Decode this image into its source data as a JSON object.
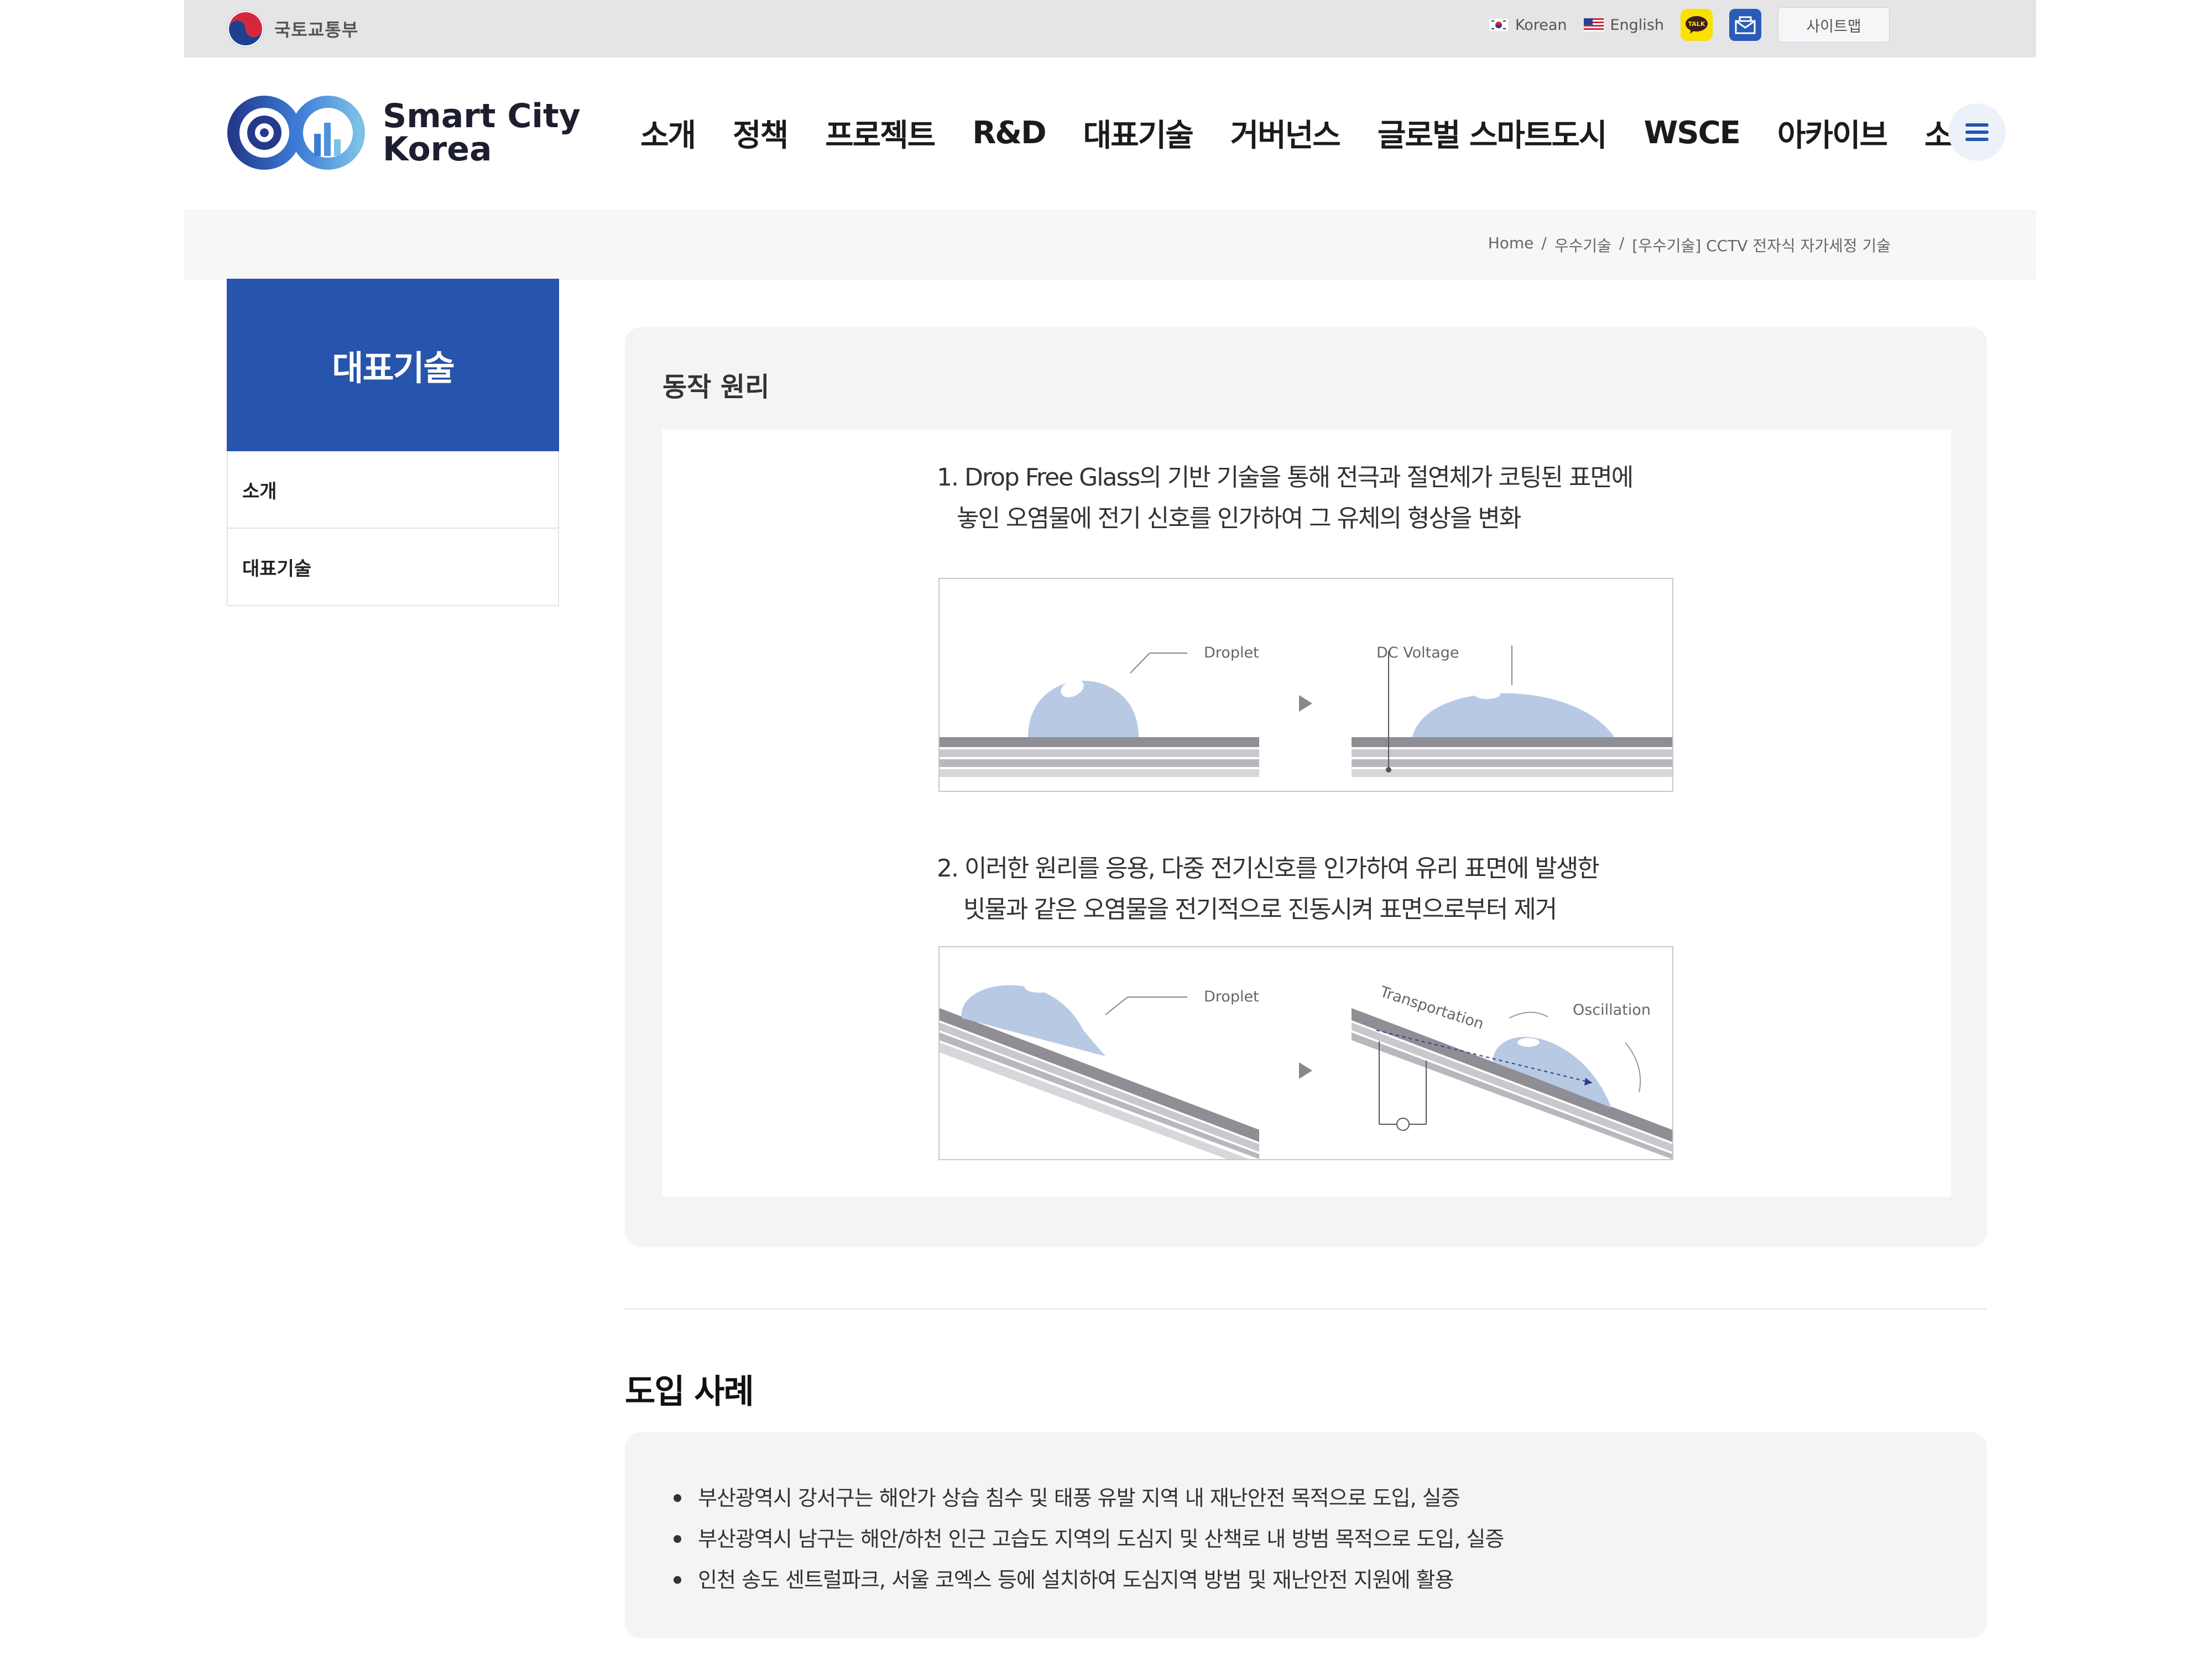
{
  "utility_bar": {
    "ministry_name": "국토교통부",
    "lang_korean": "Korean",
    "lang_english": "English",
    "talk_badge": "TALK",
    "sitemap_label": "사이트맵"
  },
  "header": {
    "logo_line1": "Smart City",
    "logo_line2": "Korea",
    "nav": [
      "소개",
      "정책",
      "프로젝트",
      "R&D",
      "대표기술",
      "거버넌스",
      "글로벌 스마트도시",
      "WSCE",
      "아카이브",
      "소식"
    ]
  },
  "breadcrumb": [
    "Home",
    "/",
    "우수기술",
    "/",
    "[우수기술] CCTV 전자식 자가세정 기술"
  ],
  "sidebar": {
    "title": "대표기술",
    "items": [
      "소개",
      "대표기술"
    ]
  },
  "principle": {
    "title": "동작 원리",
    "step1": "1. Drop Free Glass의 기반 기술을 통해 전극과 절연체가 코팅된 표면에\n   놓인 오염물에 전기 신호를 인가하여 그 유체의 형상을 변화",
    "step2": "2. 이러한 원리를 응용, 다중 전기신호를 인가하여 유리 표면에 발생한\n    빗물과 같은 오염물을 전기적으로 진동시켜 표면으로부터 제거",
    "diagram1": {
      "label_droplet": "Droplet",
      "label_dc": "DC Voltage"
    },
    "diagram2": {
      "label_droplet": "Droplet",
      "label_transport": "Transportation",
      "label_osc": "Oscillation"
    }
  },
  "cases": {
    "title": "도입 사례",
    "items": [
      "부산광역시 강서구는 해안가 상습 침수 및 태풍 유발 지역 내 재난안전 목적으로 도입, 실증",
      "부산광역시 남구는 해안/하천 인근 고습도 지역의 도심지 및 산책로 내 방범 목적으로 도입, 실증",
      "인천 송도 센트럴파크, 서울 코엑스 등에 설치하여 도심지역 방범 및 재난안전 지원에 활용"
    ]
  },
  "colors": {
    "brand_blue": "#2755ad",
    "droplet": "#b8c9e4",
    "kakao_yellow": "#fae100"
  }
}
